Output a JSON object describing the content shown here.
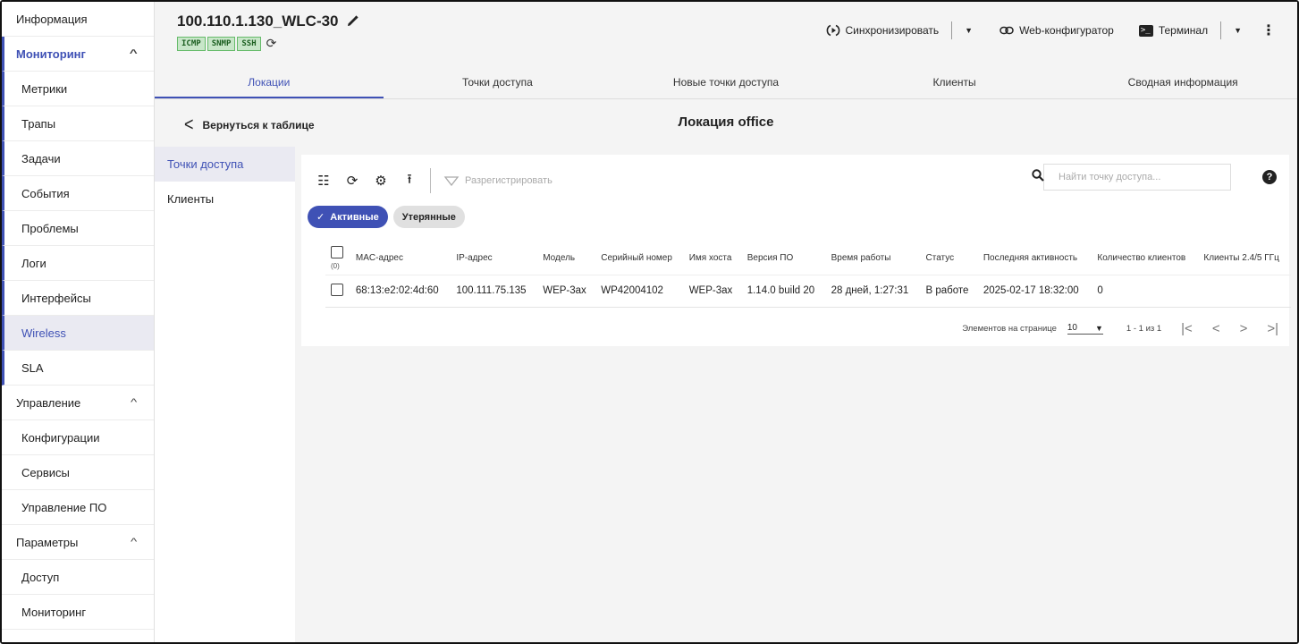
{
  "sidebar": {
    "items": [
      {
        "label": "Информация",
        "kind": "top"
      },
      {
        "label": "Мониторинг",
        "kind": "group",
        "expanded": true,
        "chevron": "^"
      },
      {
        "label": "Метрики",
        "kind": "sub"
      },
      {
        "label": "Трапы",
        "kind": "sub"
      },
      {
        "label": "Задачи",
        "kind": "sub"
      },
      {
        "label": "События",
        "kind": "sub"
      },
      {
        "label": "Проблемы",
        "kind": "sub"
      },
      {
        "label": "Логи",
        "kind": "sub"
      },
      {
        "label": "Интерфейсы",
        "kind": "sub"
      },
      {
        "label": "Wireless",
        "kind": "sub",
        "selected": true
      },
      {
        "label": "SLA",
        "kind": "sub"
      },
      {
        "label": "Управление",
        "kind": "group",
        "chevron": "^"
      },
      {
        "label": "Конфигурации",
        "kind": "sub"
      },
      {
        "label": "Сервисы",
        "kind": "sub"
      },
      {
        "label": "Управление ПО",
        "kind": "sub"
      },
      {
        "label": "Параметры",
        "kind": "group",
        "chevron": "^"
      },
      {
        "label": "Доступ",
        "kind": "sub"
      },
      {
        "label": "Мониторинг",
        "kind": "sub"
      }
    ]
  },
  "header": {
    "device_name": "100.110.1.130_WLC-30",
    "protocols": [
      "ICMP",
      "SNMP",
      "SSH"
    ],
    "sync_label": "Синхронизировать",
    "web_label": "Web-конфигуратор",
    "terminal_label": "Терминал"
  },
  "tabs": [
    {
      "label": "Локации",
      "active": true
    },
    {
      "label": "Точки доступа"
    },
    {
      "label": "Новые точки доступа"
    },
    {
      "label": "Клиенты"
    },
    {
      "label": "Сводная информация"
    }
  ],
  "backbar": {
    "back_label": "Вернуться к таблице",
    "title": "Локация office"
  },
  "inner_nav": [
    {
      "label": "Точки доступа",
      "active": true
    },
    {
      "label": "Клиенты"
    }
  ],
  "toolbar": {
    "deregister_label": "Разрегистрировать",
    "search_placeholder": "Найти точку доступа..."
  },
  "chips": {
    "active_label": "Активные",
    "lost_label": "Утерянные"
  },
  "table": {
    "select_count": "(0)",
    "columns": [
      "MAC-адрес",
      "IP-адрес",
      "Модель",
      "Серийный номер",
      "Имя хоста",
      "Версия ПО",
      "Время работы",
      "Статус",
      "Последняя активность",
      "Количество клиентов",
      "Клиенты 2.4/5 ГГц"
    ],
    "rows": [
      [
        "68:13:e2:02:4d:60",
        "100.111.75.135",
        "WEP-3ax",
        "WP42004102",
        "WEP-3ax",
        "1.14.0 build 20",
        "28 дней, 1:27:31",
        "В работе",
        "2025-02-17 18:32:00",
        "0",
        ""
      ]
    ]
  },
  "paginator": {
    "per_page_label": "Элементов на странице",
    "per_page_value": "10",
    "range": "1 - 1 из 1"
  },
  "colors": {
    "accent": "#3f51b5",
    "badge_bg": "#c8e6c9"
  }
}
